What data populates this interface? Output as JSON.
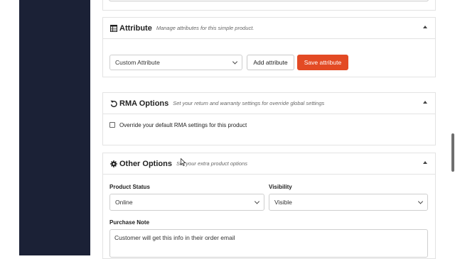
{
  "attribute": {
    "title": "Attribute",
    "description": "Manage attributes for this simple product.",
    "select_value": "Custom Attribute",
    "add_button": "Add attribute",
    "save_button": "Save attribute"
  },
  "rma": {
    "title": "RMA Options",
    "description": "Set your return and warranty settings for override global settings",
    "checkbox_label": "Override your default RMA settings for this product"
  },
  "other": {
    "title": "Other Options",
    "description": "Set your extra product options",
    "status_label": "Product Status",
    "status_value": "Online",
    "visibility_label": "Visibility",
    "visibility_value": "Visible",
    "note_label": "Purchase Note",
    "note_value": "Customer will get this info in their order email"
  },
  "colors": {
    "sidebar": "#1b2136",
    "accent": "#e34a24"
  }
}
